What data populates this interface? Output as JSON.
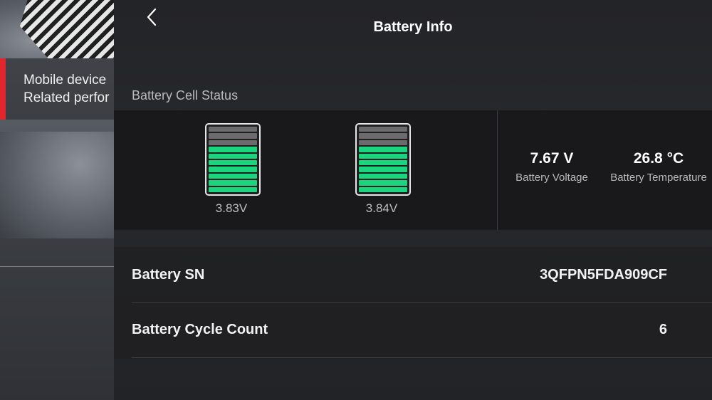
{
  "sidebar": {
    "item_line1": "Mobile device",
    "item_line2": "Related perfor",
    "accent_color": "#e3262b"
  },
  "header": {
    "title": "Battery Info",
    "back_icon": "chevron-left-icon"
  },
  "battery_cell_status": {
    "label": "Battery Cell Status",
    "cells": [
      {
        "voltage": "3.83V",
        "filled_segments": 7,
        "total_segments": 10
      },
      {
        "voltage": "3.84V",
        "filled_segments": 7,
        "total_segments": 10
      }
    ],
    "fill_color": "#1bd47e",
    "voltage": {
      "value": "7.67 V",
      "label": "Battery Voltage"
    },
    "temperature": {
      "value": "26.8 °C",
      "label": "Battery Temperature"
    }
  },
  "details": [
    {
      "label": "Battery SN",
      "value": "3QFPN5FDA909CF"
    },
    {
      "label": "Battery Cycle Count",
      "value": "6"
    }
  ]
}
